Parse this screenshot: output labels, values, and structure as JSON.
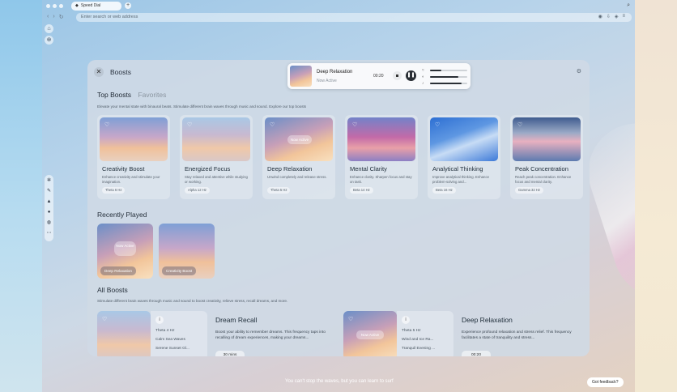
{
  "browser": {
    "tab_title": "Speed Dial",
    "new_tab_label": "+",
    "url_placeholder": "Enter search or web address",
    "top_right_icon": "search-icon"
  },
  "panel": {
    "title": "Boosts",
    "tabs": [
      {
        "label": "Top Boosts",
        "active": true
      },
      {
        "label": "Favorites",
        "active": false
      }
    ],
    "top_description": "Elevate your mental state with binaural beats. Stimulate different brain waves through music and sound. Explore our top boosts",
    "top_boosts": [
      {
        "name": "Creativity Boost",
        "desc": "Enhance creativity and stimulate your imagination.",
        "freq": "Theta 6 Hz",
        "sky": "sky1",
        "now_active": false
      },
      {
        "name": "Energized Focus",
        "desc": "Stay relaxed and attentive while studying or working.",
        "freq": "Alpha 12 Hz",
        "sky": "sky2",
        "now_active": false
      },
      {
        "name": "Deep Relaxation",
        "desc": "Unwind completely and release stress.",
        "freq": "Theta 5 Hz",
        "sky": "sky3",
        "now_active": true,
        "badge": "Now Active"
      },
      {
        "name": "Mental Clarity",
        "desc": "Enhance clarity. Sharpen focus and stay on task.",
        "freq": "Beta 14 Hz",
        "sky": "sky4",
        "now_active": false
      },
      {
        "name": "Analytical Thinking",
        "desc": "Improve analytical thinking. Enhance problem-solving and...",
        "freq": "Beta 16 Hz",
        "sky": "sky5",
        "now_active": false
      },
      {
        "name": "Peak Concentration",
        "desc": "Reach peak concentration. Enhance focus and mental clarity.",
        "freq": "Gamma 32 Hz",
        "sky": "sky6",
        "now_active": false
      }
    ],
    "recently_played_title": "Recently Played",
    "recently_played": [
      {
        "label": "Deep Relaxation",
        "badge": "Now Active",
        "sky": "sky3"
      },
      {
        "label": "Creativity Boost",
        "sky": "sky1"
      }
    ],
    "all_boosts_title": "All Boosts",
    "all_description": "Stimulate different brain waves through music and sound to boost creativity, relieve stress, recall dreams, and more.",
    "all_boosts": [
      {
        "title": "Dream Recall",
        "freq": "Theta 4 Hz",
        "sound": "Calm Sea Waves",
        "scene": "Serene Sunset Gl...",
        "desc": "Boost your ability to remember dreams. This frequency taps into recalling of dream experiences, making your dreams...",
        "duration": "30 mins",
        "sky": "sky2",
        "now_active": false
      },
      {
        "title": "Deep Relaxation",
        "freq": "Theta 5 Hz",
        "sound": "Wind and Ice Ra...",
        "scene": "Tranquil Evening ...",
        "desc": "Experience profound relaxation and stress relief. This frequency facilitates a state of tranquility and stress...",
        "duration": "00:20",
        "sky": "sky3",
        "now_active": true,
        "badge": "Now Active"
      }
    ]
  },
  "player": {
    "title": "Deep Relaxation",
    "status": "Now Active",
    "time": "00:20",
    "sliders": [
      {
        "icon": "waves-icon",
        "level": 0.3
      },
      {
        "icon": "sound-icon",
        "level": 0.75
      },
      {
        "icon": "music-icon",
        "level": 0.85
      }
    ]
  },
  "footer": {
    "quote": "You can't stop the waves, but you can learn to surf",
    "feedback": "Got feedback?"
  }
}
